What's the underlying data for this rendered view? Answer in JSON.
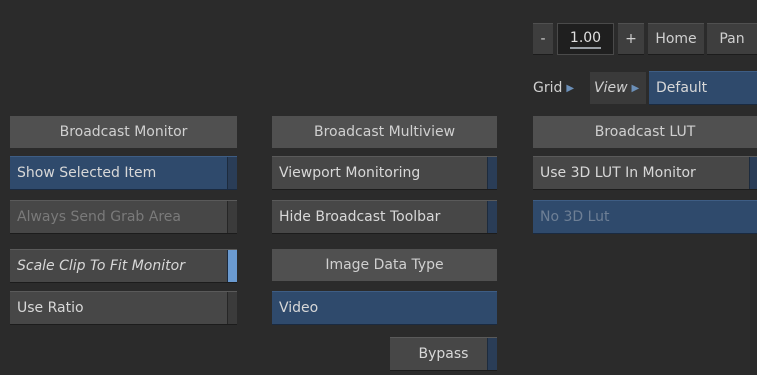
{
  "zoom": {
    "minus": "-",
    "value": "1.00",
    "plus": "+",
    "home": "Home",
    "pan": "Pan"
  },
  "view_row": {
    "grid": "Grid",
    "view": "View",
    "default": "Default"
  },
  "left": {
    "header": "Broadcast Monitor",
    "show_selected": "Show Selected Item",
    "always_send": "Always Send Grab Area",
    "scale_clip": "Scale Clip To Fit Monitor",
    "use_ratio": "Use Ratio"
  },
  "middle": {
    "header": "Broadcast Multiview",
    "viewport_monitoring": "Viewport Monitoring",
    "hide_toolbar": "Hide Broadcast Toolbar",
    "image_data_type": "Image Data Type",
    "video": "Video",
    "bypass": "Bypass"
  },
  "right": {
    "header": "Broadcast LUT",
    "use_3d_lut": "Use 3D LUT In Monitor",
    "no_3d_lut": "No 3D Lut"
  }
}
